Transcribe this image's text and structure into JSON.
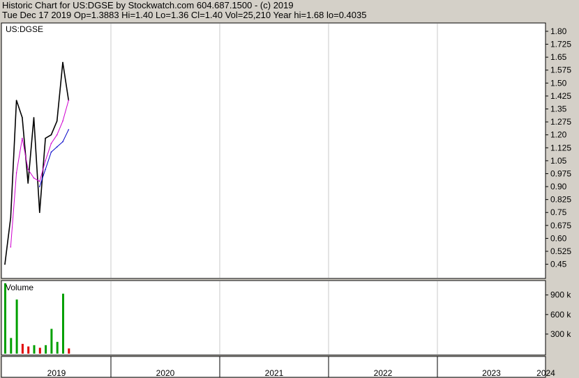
{
  "header": {
    "line1": "Historic Chart for US:DGSE by Stockwatch.com 604.687.1500 - (c) 2019",
    "line2": "Tue Dec 17 2019  Op=1.3883  Hi=1.40  Lo=1.36  Cl=1.40  Vol=25,210  Year hi=1.68  lo=0.4035"
  },
  "colors": {
    "background": "#d4d0c8",
    "panel": "#ffffff",
    "grid": "#c8c8c8",
    "price": "#000000",
    "ma_short": "#d000d0",
    "ma_long": "#0000c8",
    "volume_up": "#00a000",
    "volume_down": "#e00000"
  },
  "chart_data": [
    {
      "type": "line",
      "title": "US:DGSE",
      "ylim": [
        0.4,
        1.82
      ],
      "y_ticks": [
        "1.80",
        "1.725",
        "1.65",
        "1.575",
        "1.50",
        "1.425",
        "1.35",
        "1.275",
        "1.20",
        "1.125",
        "1.05",
        "0.975",
        "0.90",
        "0.825",
        "0.75",
        "0.675",
        "0.60",
        "0.525",
        "0.45"
      ],
      "x_labels": [
        "2019",
        "2020",
        "2021",
        "2022",
        "2023",
        "2024"
      ],
      "grid": true,
      "series": [
        {
          "key": "price",
          "x": [
            "2019-01",
            "2019-02",
            "2019-03",
            "2019-04",
            "2019-05",
            "2019-06",
            "2019-07",
            "2019-08",
            "2019-09",
            "2019-10",
            "2019-11",
            "2019-12"
          ],
          "values": [
            0.45,
            0.72,
            1.4,
            1.3,
            0.92,
            1.3,
            0.75,
            1.18,
            1.2,
            1.28,
            1.62,
            1.4
          ]
        },
        {
          "key": "ma_short",
          "x": [
            "2019-02",
            "2019-03",
            "2019-04",
            "2019-05",
            "2019-06",
            "2019-07",
            "2019-08",
            "2019-09",
            "2019-10",
            "2019-11",
            "2019-12"
          ],
          "values": [
            0.55,
            0.98,
            1.18,
            1.0,
            0.95,
            0.93,
            1.05,
            1.15,
            1.2,
            1.28,
            1.4
          ]
        },
        {
          "key": "ma_long",
          "x": [
            "2019-07",
            "2019-08",
            "2019-09",
            "2019-10",
            "2019-11",
            "2019-12"
          ],
          "values": [
            0.9,
            1.0,
            1.1,
            1.13,
            1.16,
            1.23
          ]
        }
      ]
    },
    {
      "type": "bar",
      "title": "Volume",
      "ylim": [
        0,
        1100000
      ],
      "y_ticks": [
        "900 k",
        "600 k",
        "300 k"
      ],
      "x": [
        "2019-01",
        "2019-02",
        "2019-03",
        "2019-04",
        "2019-05",
        "2019-06",
        "2019-07",
        "2019-08",
        "2019-09",
        "2019-10",
        "2019-11",
        "2019-12"
      ],
      "values": [
        1080000,
        240000,
        830000,
        150000,
        110000,
        130000,
        90000,
        130000,
        380000,
        180000,
        920000,
        80000
      ]
    }
  ]
}
